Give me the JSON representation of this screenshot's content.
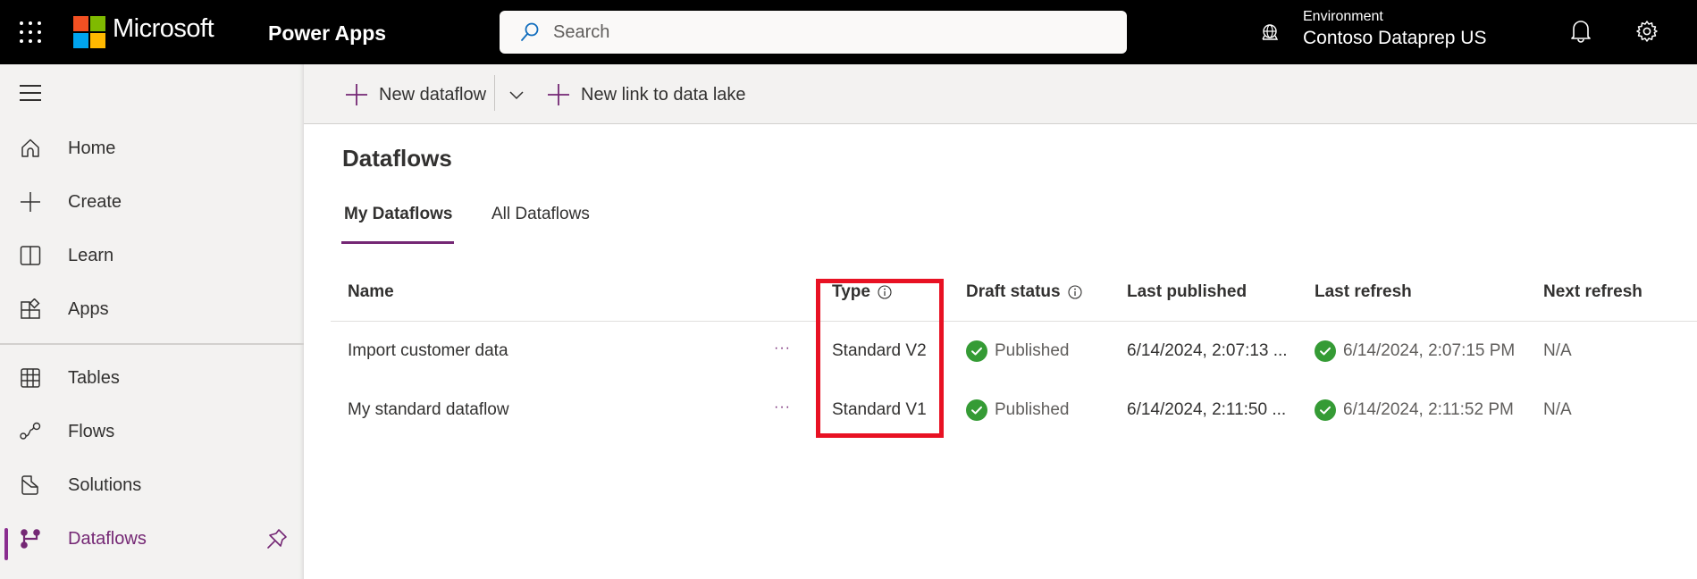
{
  "topbar": {
    "brand": "Microsoft",
    "app_name": "Power Apps",
    "search_placeholder": "Search",
    "environment_label": "Environment",
    "environment_name": "Contoso Dataprep US",
    "icons": [
      "waffle-icon",
      "microsoft-logo",
      "search-icon",
      "environment-globe-icon",
      "bell-icon",
      "gear-icon"
    ],
    "logo_colors": [
      "#f25022",
      "#7fba00",
      "#00a4ef",
      "#ffb900"
    ]
  },
  "sidebar": {
    "items": [
      {
        "label": "Home",
        "icon": "home-icon"
      },
      {
        "label": "Create",
        "icon": "plus-icon"
      },
      {
        "label": "Learn",
        "icon": "book-icon"
      },
      {
        "label": "Apps",
        "icon": "apps-icon"
      },
      {
        "label": "Tables",
        "icon": "table-icon"
      },
      {
        "label": "Flows",
        "icon": "flows-icon"
      },
      {
        "label": "Solutions",
        "icon": "solutions-icon"
      },
      {
        "label": "Dataflows",
        "icon": "dataflows-icon",
        "active": true,
        "pinned": true
      }
    ],
    "accent_color": "#742774"
  },
  "commandbar": {
    "new_dataflow": "New dataflow",
    "new_link": "New link to data lake"
  },
  "main": {
    "title": "Dataflows",
    "tabs": [
      {
        "label": "My Dataflows",
        "active": true
      },
      {
        "label": "All Dataflows",
        "active": false
      }
    ],
    "table": {
      "columns": [
        "Name",
        "Type",
        "Draft status",
        "Last published",
        "Last refresh",
        "Next refresh"
      ],
      "rows": [
        {
          "name": "Import customer data",
          "more": "···",
          "type": "Standard V2",
          "draft_status": "Published",
          "last_published": "6/14/2024, 2:07:13 ...",
          "last_refresh": "6/14/2024, 2:07:15 PM",
          "next_refresh": "N/A"
        },
        {
          "name": "My standard dataflow",
          "more": "···",
          "type": "Standard V1",
          "draft_status": "Published",
          "last_published": "6/14/2024, 2:11:50 ...",
          "last_refresh": "6/14/2024, 2:11:52 PM",
          "next_refresh": "N/A"
        }
      ],
      "status_color": "#359b35",
      "highlight_color": "#e81123"
    }
  }
}
